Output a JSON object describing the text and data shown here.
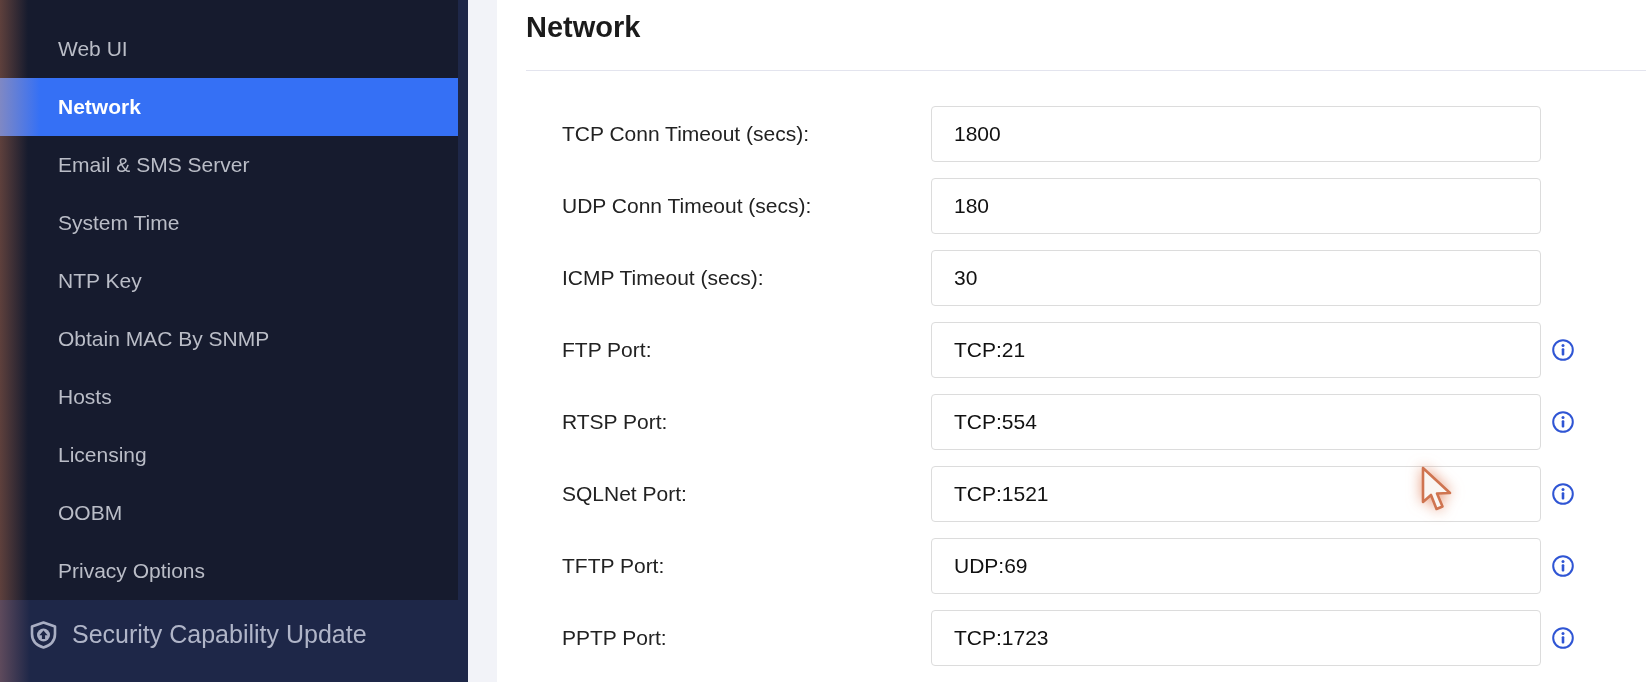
{
  "sidebar": {
    "items": [
      {
        "label": "Web UI",
        "selected": false
      },
      {
        "label": "Network",
        "selected": true
      },
      {
        "label": "Email & SMS Server",
        "selected": false
      },
      {
        "label": "System Time",
        "selected": false
      },
      {
        "label": "NTP Key",
        "selected": false
      },
      {
        "label": "Obtain MAC By SNMP",
        "selected": false
      },
      {
        "label": "Hosts",
        "selected": false
      },
      {
        "label": "Licensing",
        "selected": false
      },
      {
        "label": "OOBM",
        "selected": false
      },
      {
        "label": "Privacy Options",
        "selected": false
      }
    ],
    "section": {
      "label": "Security Capability Update"
    }
  },
  "content": {
    "title": "Network",
    "fields": [
      {
        "label": "TCP Conn Timeout (secs):",
        "value": "1800",
        "info": false
      },
      {
        "label": "UDP Conn Timeout (secs):",
        "value": "180",
        "info": false
      },
      {
        "label": "ICMP Timeout (secs):",
        "value": "30",
        "info": false
      },
      {
        "label": "FTP Port:",
        "value": "TCP:21",
        "info": true
      },
      {
        "label": "RTSP Port:",
        "value": "TCP:554",
        "info": true
      },
      {
        "label": "SQLNet Port:",
        "value": "TCP:1521",
        "info": true
      },
      {
        "label": "TFTP Port:",
        "value": "UDP:69",
        "info": true
      },
      {
        "label": "PPTP Port:",
        "value": "TCP:1723",
        "info": true
      }
    ]
  }
}
